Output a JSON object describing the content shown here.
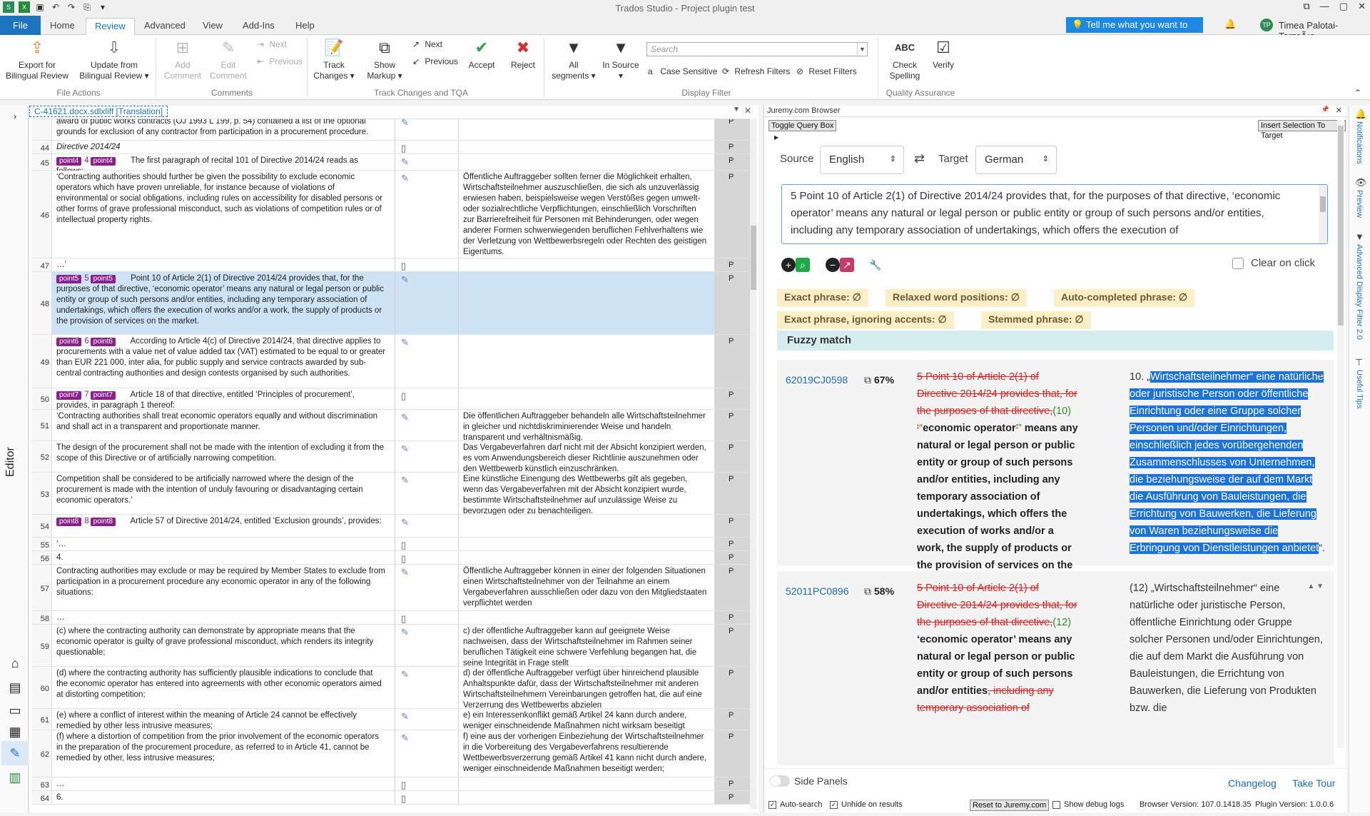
{
  "window": {
    "title": "Trados Studio - Project plugin test"
  },
  "tabs": {
    "file": "File",
    "home": "Home",
    "review": "Review",
    "advanced": "Advanced",
    "view": "View",
    "addins": "Add-Ins",
    "help": "Help"
  },
  "tellme": "Tell me what you want to do...",
  "user": {
    "initials": "TP",
    "name": "Timea Palotai-TorzsÃ¡s"
  },
  "ribbon": {
    "export": "Export for Bilingual Review",
    "update": "Update from Bilingual Review",
    "file_actions": "File Actions",
    "add_comment": "Add Comment",
    "edit_comment": "Edit Comment",
    "next": "Next",
    "previous": "Previous",
    "comments": "Comments",
    "track_changes": "Track Changes",
    "show_markup": "Show Markup",
    "next2": "Next",
    "previous2": "Previous",
    "accept": "Accept",
    "reject": "Reject",
    "tc_group": "Track Changes and TQA",
    "all_segments": "All segments",
    "in_source": "In Source",
    "search_placeholder": "Search",
    "case_sensitive": "Case Sensitive",
    "refresh_filters": "Refresh Filters",
    "reset_filters": "Reset Filters",
    "display_filter": "Display Filter",
    "check_spelling": "Check Spelling",
    "verify": "Verify",
    "qa": "Quality Assurance"
  },
  "editor": {
    "side_label": "Editor",
    "tab": "C-41621.docx.sdlxliff [Translation]",
    "rows": [
      {
        "n": "",
        "src": "award of public works contracts (OJ 1993 L 199, p. 54) contained a list of the optional grounds for exclusion of any contractor from participation in a procurement procedure.",
        "tgt": "",
        "st": "P",
        "icon": "pen"
      },
      {
        "n": "44",
        "src": "Directive 2014/24",
        "tgt": "",
        "st": "P",
        "icon": "doc"
      },
      {
        "n": "45",
        "tag": "point4",
        "tagnum": "4",
        "src": "The first paragraph of recital 101 of Directive 2014/24 reads as follows:",
        "tgt": "",
        "st": "P",
        "icon": "pen"
      },
      {
        "n": "46",
        "src": "‘Contracting authorities should further be given the possibility to exclude economic operators which have proven unreliable, for instance because of violations of environmental or social obligations, including rules on accessibility for disabled persons or other forms of grave professional misconduct, such as violations of competition rules or of intellectual property rights.",
        "tgt": "Öffentliche Auftraggeber sollten ferner die Möglichkeit erhalten, Wirtschaftsteilnehmer auszuschließen, die sich als unzuverlässig erwiesen haben, beispielsweise wegen Verstößes gegen umwelt- oder sozialrechtliche Verpflichtungen, einschließlich Vorschriften zur Barrierefreiheit für Personen mit Behinderungen, oder wegen anderer Formen schwerwiegenden beruflichen Fehlverhaltens wie der Verletzung von Wettbewerbsregeln oder Rechten des geistigen Eigentums.",
        "st": "P",
        "icon": "pen"
      },
      {
        "n": "47",
        "src": "…’",
        "tgt": "",
        "st": "P",
        "icon": "doc"
      },
      {
        "n": "48",
        "tag": "point5",
        "tagnum": "5",
        "src": "Point 10 of Article 2(1) of Directive 2014/24 provides that, for the purposes of that directive, ‘economic operator’ means any natural or legal person or public entity or group of such persons and/or entities, including any temporary association of undertakings, which offers the execution of works and/or a work, the supply of products or the provision of services on the market.",
        "tgt": "",
        "st": "P",
        "icon": "pen",
        "sel": true
      },
      {
        "n": "49",
        "tag": "point6",
        "tagnum": "6",
        "src": "According to Article 4(c) of Directive 2014/24, that directive applies to procurements with a value net of value added tax (VAT) estimated to be equal to or greater than EUR 221 000, inter alia, for public supply and service contracts awarded by sub-central contracting authorities and design contests organised by such authorities.",
        "tgt": "",
        "st": "P",
        "icon": "pen"
      },
      {
        "n": "50",
        "tag": "point7",
        "tagnum": "7",
        "src": "Article 18 of that directive, entitled ‘Principles of procurement’, provides, in paragraph 1 thereof:",
        "tgt": "",
        "st": "P",
        "icon": "doc"
      },
      {
        "n": "51",
        "src": "‘Contracting authorities shall treat economic operators equally and without discrimination and shall act in a transparent and proportionate manner.",
        "tgt": "Die öffentlichen Auftraggeber behandeln alle Wirtschaftsteilnehmer in gleicher und nichtdiskriminierender Weise und handeln transparent und verhältnismäßig.",
        "st": "P",
        "icon": "pen"
      },
      {
        "n": "52",
        "src": "The design of the procurement shall not be made with the intention of excluding it from the scope of this Directive or of artificially narrowing competition.",
        "tgt": "Das Vergabeverfahren darf nicht mit der Absicht konzipiert werden, es vom Anwendungsbereich dieser Richtlinie auszunehmen oder den Wettbewerb künstlich einzuschränken.",
        "st": "P",
        "icon": "pen"
      },
      {
        "n": "53",
        "src": "Competition shall be considered to be artificially narrowed where the design of the procurement is made with the intention of unduly favouring or disadvantaging certain economic operators.’",
        "tgt": "Eine künstliche Einengung des Wettbewerbs gilt als gegeben, wenn das Vergabeverfahren mit der Absicht konzipiert wurde, bestimmte Wirtschaftsteilnehmer auf unzulässige Weise zu bevorzugen oder zu benachteiligen.",
        "st": "P",
        "icon": "pen"
      },
      {
        "n": "54",
        "tag": "point8",
        "tagnum": "8",
        "src": "Article 57 of Directive 2014/24, entitled ‘Exclusion grounds’, provides:",
        "tgt": "",
        "st": "P",
        "icon": "pen"
      },
      {
        "n": "55",
        "src": "‘…",
        "tgt": "",
        "st": "P",
        "icon": "doc"
      },
      {
        "n": "56",
        "src": "4.",
        "tgt": "",
        "st": "P",
        "icon": "doc"
      },
      {
        "n": "57",
        "src": "Contracting authorities may exclude or may be required by Member States to exclude from participation in a procurement procedure any economic operator in any of the following situations:",
        "tgt": "Öffentliche Auftraggeber können in einer der folgenden Situationen einen Wirtschaftsteilnehmer von der Teilnahme an einem Vergabeverfahren ausschließen oder dazu von den Mitgliedstaaten verpflichtet werden",
        "st": "P",
        "icon": "pen"
      },
      {
        "n": "58",
        "src": "…",
        "tgt": "",
        "st": "P",
        "icon": "doc"
      },
      {
        "n": "59",
        "src": "(c)      where the contracting authority can demonstrate by appropriate means that the economic operator is guilty of grave professional misconduct, which renders its integrity questionable;",
        "tgt": "c) der öffentliche Auftraggeber kann auf geeignete Weise nachweisen, dass der Wirtschaftsteilnehmer im Rahmen seiner beruflichen Tätigkeit eine schwere Verfehlung begangen hat, die seine Integrität in Frage stellt",
        "st": "P",
        "icon": "pen"
      },
      {
        "n": "60",
        "src": "(d)      where the contracting authority has sufficiently plausible indications to conclude that the economic operator has entered into agreements with other economic operators aimed at distorting competition;",
        "tgt": "d) der öffentliche Auftraggeber verfügt über hinreichend plausible Anhaltspunkte dafür, dass der Wirtschaftsteilnehmer mit anderen Wirtschaftsteilnehmern Vereinbarungen getroffen hat, die auf eine Verzerrung des Wettbewerbs abzielen",
        "st": "P",
        "icon": "pen"
      },
      {
        "n": "61",
        "src": "(e)      where a conflict of interest within the meaning of Article 24 cannot be effectively remedied by other less intrusive measures;",
        "tgt": "e) ein Interessenkonflikt gemäß Artikel 24 kann durch andere, weniger einschneidende Maßnahmen nicht wirksam beseitigt werden",
        "st": "P",
        "icon": "pen"
      },
      {
        "n": "62",
        "src": "(f)      where a distortion of competition from the prior involvement of the economic operators in the preparation of the procurement procedure, as referred to in Article 41, cannot be remedied by other, less intrusive measures;",
        "tgt": "f) eine aus der vorherigen Einbeziehung der Wirtschaftsteilnehmer in die Vorbereitung des Vergabeverfahrens resultierende Wettbewerbsverzerrung gemäß Artikel 41 kann nicht durch andere, weniger einschneidende Maßnahmen beseitigt werden;",
        "st": "P",
        "icon": "pen"
      },
      {
        "n": "63",
        "src": "…",
        "tgt": "",
        "st": "P",
        "icon": "doc"
      },
      {
        "n": "64",
        "src": "6.",
        "tgt": "",
        "st": "P",
        "icon": "doc"
      }
    ]
  },
  "juremy": {
    "title": "Juremy.com Browser",
    "toggle_query": "Toggle Query Box",
    "insert_sel": "Insert Selection To Target",
    "source_label": "Source",
    "source_val": "English",
    "target_label": "Target",
    "target_val": "German",
    "query": "5      Point 10 of Article 2(1) of Directive 2014/24 provides that, for the purposes of that directive, ‘economic operator’ means any natural or legal person or public entity or group of such persons and/or entities, including any temporary association of undertakings, which offers the execution of",
    "clear_on_click": "Clear on click",
    "chips": [
      "Exact phrase: ∅",
      "Relaxed word positions: ∅",
      "Auto-completed phrase: ∅",
      "Exact phrase, ignoring accents: ∅",
      "Stemmed phrase: ∅"
    ],
    "fuzzy_header": "Fuzzy match",
    "card1": {
      "id": "62019CJ0598",
      "pct": "67%",
      "del": "5 Point 10 of Article 2(1) of Directive 2014/24 provides that, for the purposes of that directive,",
      "ins": "(10)",
      "del2": "‘",
      "ins2": "“",
      "body": "economic operator",
      "del3": "’",
      "ins3": "”",
      "rest": " means any natural or legal person or public entity or group of such persons and/or entities, including any temporary association of undertakings, which offers the execution of works and/or a work, the supply of products or the provision of services on the market.’",
      "tgt_pre": "10. „",
      "tgt_hl": "Wirtschaftsteilnehmer“ eine natürliche oder juristische Person oder öffentliche Einrichtung oder eine Gruppe solcher Personen und/oder Einrichtungen, einschließlich jedes vorübergehenden Zusammenschlusses von Unternehmen, die beziehungsweise der auf dem Markt die Ausführung von Bauleistungen, die Errichtung von Bauwerken, die Lieferung von Waren beziehungsweise die Erbringung von Dienstleistungen anbietet",
      "tgt_post": "“."
    },
    "card2": {
      "id": "52011PC0896",
      "pct": "58%",
      "del": "5 Point 10 of Article 2(1) of Directive 2014/24 provides that, for the purposes of that directive,",
      "ins": "(12)",
      "body": "‘economic operator’ means any natural or legal person or public entity or group of such persons and/or entities",
      "del2": ", including any temporary association of",
      "tgt": "(12) „Wirtschaftsteilnehmer“ eine natürliche oder juristische Person, öffentliche Einrichtung oder Gruppe solcher Personen und/oder Einrichtungen, die auf dem Markt die Ausführung von Bauleistungen, die Errichtung von Bauwerken, die Lieferung von Produkten bzw. die"
    },
    "side_panels": "Side Panels",
    "changelog": "Changelog",
    "take_tour": "Take Tour",
    "auto_search": "Auto-search",
    "unhide": "Unhide on results",
    "reset_btn": "Reset to Juremy.com",
    "show_debug": "Show debug logs",
    "browser_version": "Browser Version:  107.0.1418.35",
    "plugin_version": "Plugin Version:  1.0.0.6"
  },
  "rightbar": {
    "notifications": "Notifications",
    "preview": "Preview",
    "adv_filter": "Advanced Display Filter 2.0",
    "useful_tips": "Useful Tips"
  },
  "colors": {
    "accent": "#1e73be",
    "tag": "#8b1f8b",
    "selected_row": "#cfe3f7",
    "highlight": "#1e73d8"
  }
}
